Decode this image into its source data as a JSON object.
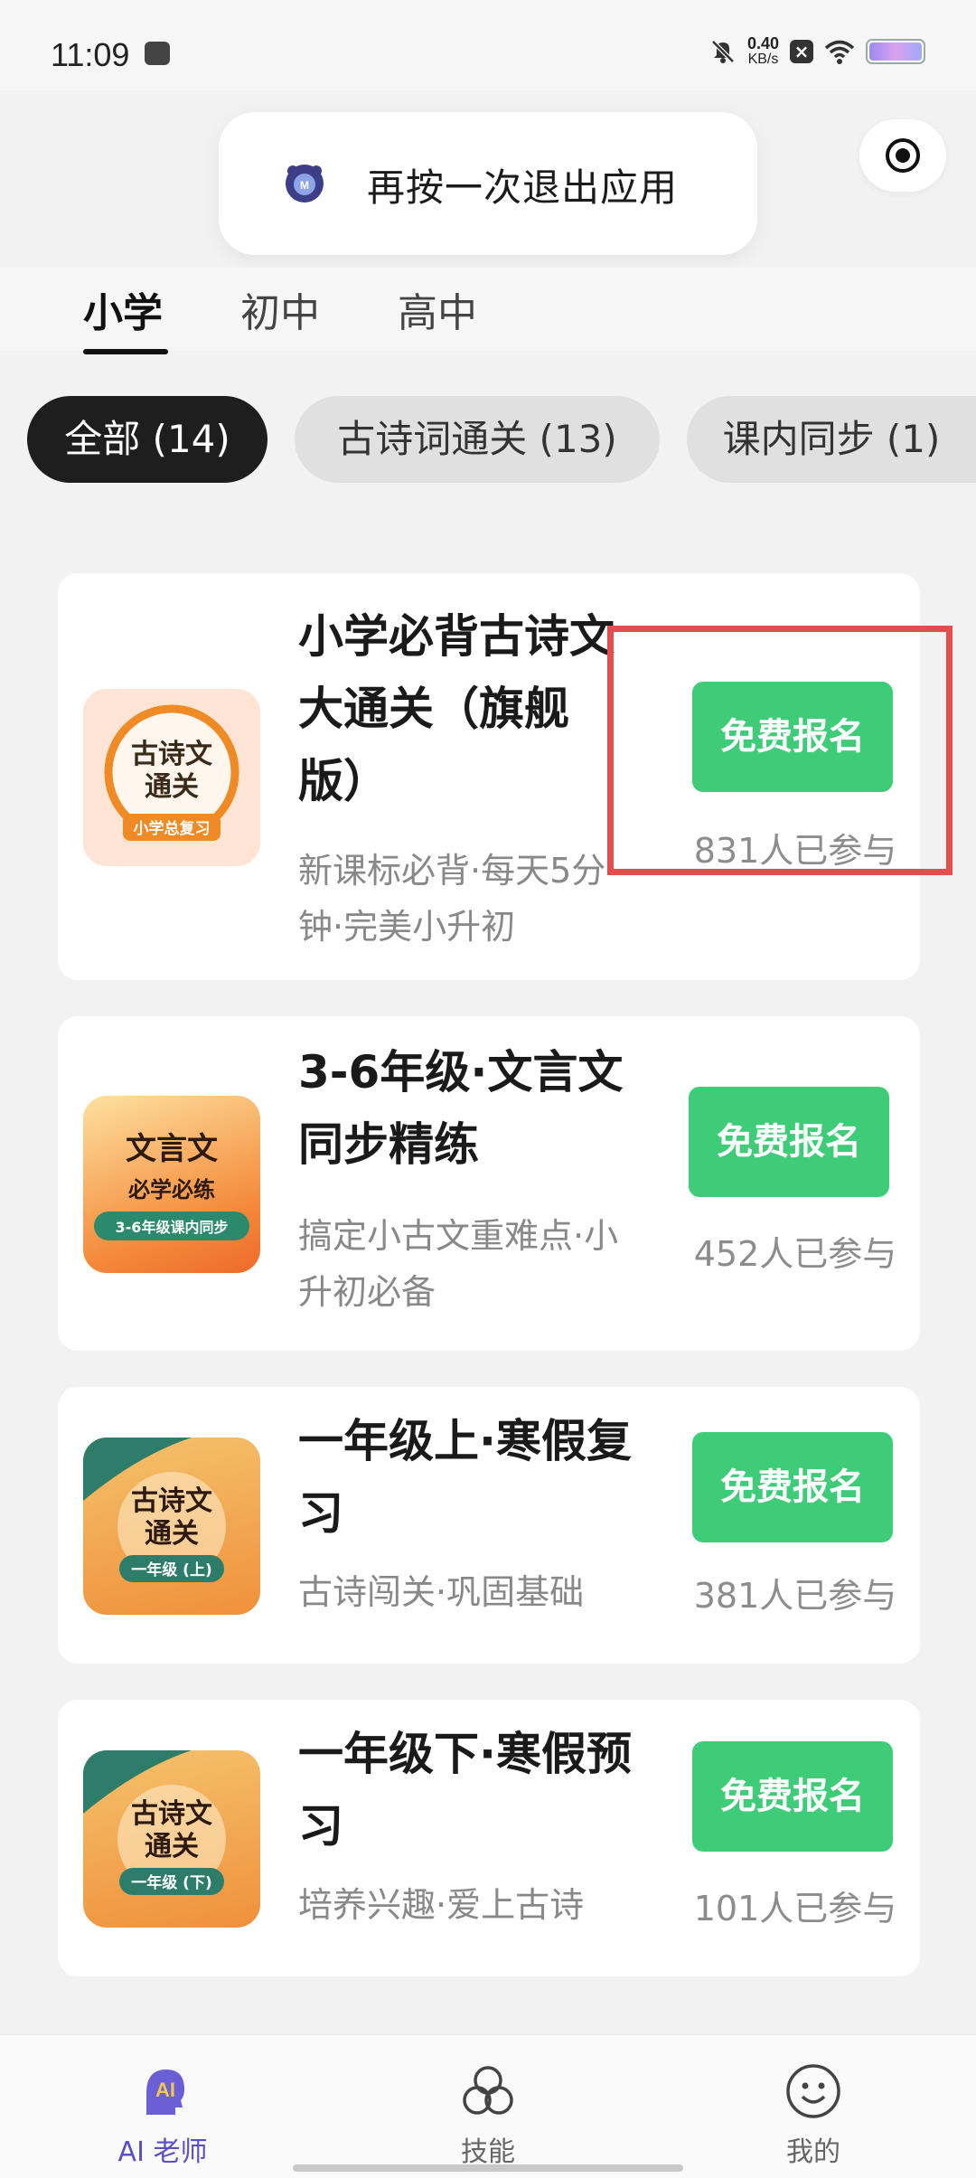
{
  "status_bar": {
    "time": "11:09",
    "net_speed_value": "0.40",
    "net_speed_unit": "KB/s",
    "icons": [
      "notification-icon",
      "mute-icon",
      "close-box-icon",
      "wifi-icon",
      "battery-icon"
    ]
  },
  "toast": {
    "text": "再按一次退出应用"
  },
  "level_tabs": [
    {
      "label": "小学",
      "active": true
    },
    {
      "label": "初中",
      "active": false
    },
    {
      "label": "高中",
      "active": false
    }
  ],
  "filter_chips": [
    {
      "label": "全部 (14)",
      "active": true
    },
    {
      "label": "古诗词通关 (13)",
      "active": false
    },
    {
      "label": "课内同步 (1)",
      "active": false
    }
  ],
  "courses": [
    {
      "thumb": {
        "line1": "古诗文",
        "line2": "通关",
        "badge": "小学总复习"
      },
      "title_lines": [
        "小学必背古诗文",
        "大通关（旗舰",
        "版）"
      ],
      "subtitle_lines": [
        "新课标必背·每天5分",
        "钟·完美小升初"
      ],
      "button": "免费报名",
      "participants": "831人已参与"
    },
    {
      "thumb": {
        "line1": "文言文",
        "line2": "必学必练",
        "badge": "3-6年级课内同步"
      },
      "title_lines": [
        "3-6年级·文言文",
        "同步精练"
      ],
      "subtitle_lines": [
        "搞定小古文重难点·小",
        "升初必备"
      ],
      "button": "免费报名",
      "participants": "452人已参与"
    },
    {
      "thumb": {
        "line1": "古诗文",
        "line2": "通关",
        "badge": "一年级 (上)"
      },
      "title_lines": [
        "一年级上·寒假复",
        "习"
      ],
      "subtitle_lines": [
        "古诗闯关·巩固基础"
      ],
      "button": "免费报名",
      "participants": "381人已参与"
    },
    {
      "thumb": {
        "line1": "古诗文",
        "line2": "通关",
        "badge": "一年级 (下)"
      },
      "title_lines": [
        "一年级下·寒假预",
        "习"
      ],
      "subtitle_lines": [
        "培养兴趣·爱上古诗"
      ],
      "button": "免费报名",
      "participants": "101人已参与"
    }
  ],
  "bottom_nav": [
    {
      "label": "AI 老师",
      "icon": "ai-teacher-icon",
      "badge_text": "AI",
      "active": true
    },
    {
      "label": "技能",
      "icon": "skills-icon",
      "active": false
    },
    {
      "label": "我的",
      "icon": "smiley-icon",
      "active": false
    }
  ],
  "colors": {
    "accent_green": "#3fcc78",
    "highlight_red": "#e44d4d",
    "active_nav": "#5a4fc4"
  }
}
